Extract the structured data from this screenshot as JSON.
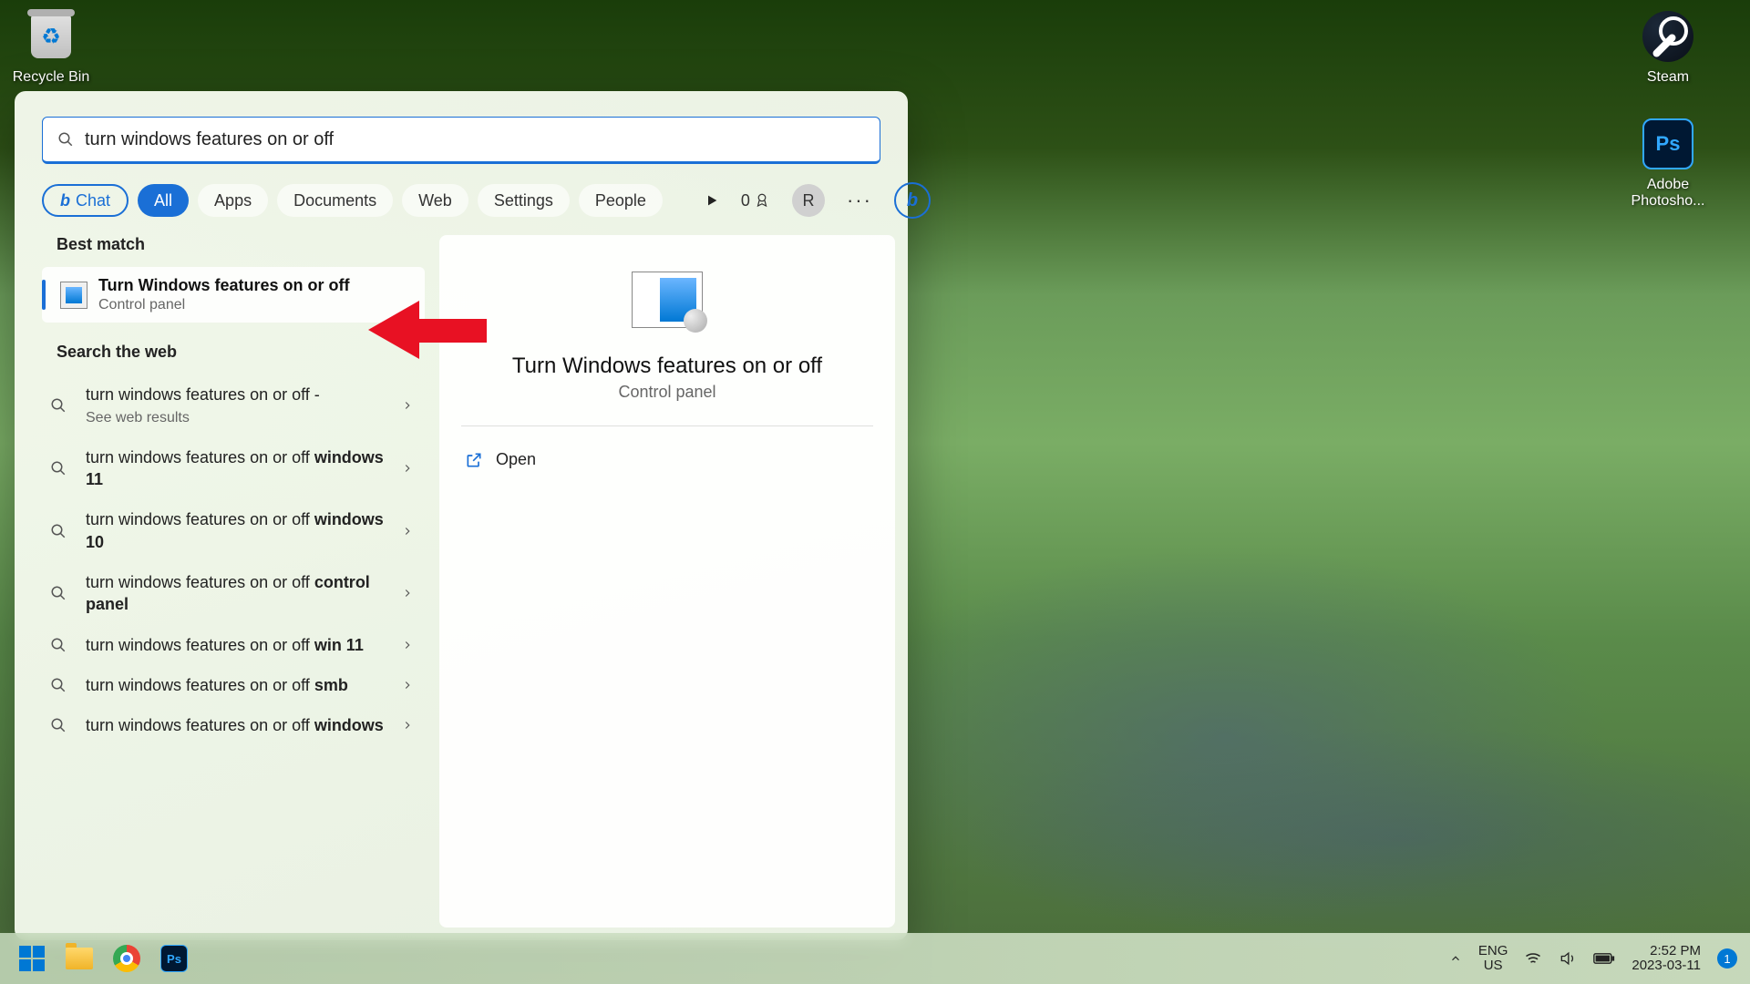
{
  "desktop": {
    "recycle_bin": "Recycle Bin",
    "steam": "Steam",
    "photoshop": "Adobe Photosho..."
  },
  "search": {
    "query": "turn windows features on or off",
    "filters": {
      "chat": "Chat",
      "all": "All",
      "apps": "Apps",
      "documents": "Documents",
      "web": "Web",
      "settings": "Settings",
      "people": "People"
    },
    "rewards_points": "0",
    "avatar_initial": "R",
    "best_match_label": "Best match",
    "best_match": {
      "title": "Turn Windows features on or off",
      "subtitle": "Control panel"
    },
    "search_web_label": "Search the web",
    "web_results": [
      {
        "prefix": "turn windows features on or off",
        "suffix": " - ",
        "sub": "See web results"
      },
      {
        "prefix": "turn windows features on or off ",
        "bold": "windows 11"
      },
      {
        "prefix": "turn windows features on or off ",
        "bold": "windows 10"
      },
      {
        "prefix": "turn windows features on or off ",
        "bold": "control panel"
      },
      {
        "prefix": "turn windows features on or off ",
        "bold": "win 11"
      },
      {
        "prefix": "turn windows features on or off ",
        "bold": "smb"
      },
      {
        "prefix": "turn windows features on or off ",
        "bold": "windows"
      }
    ],
    "detail": {
      "title": "Turn Windows features on or off",
      "subtitle": "Control panel",
      "open": "Open"
    }
  },
  "taskbar": {
    "lang_top": "ENG",
    "lang_bottom": "US",
    "time": "2:52 PM",
    "date": "2023-03-11",
    "notif_count": "1"
  }
}
